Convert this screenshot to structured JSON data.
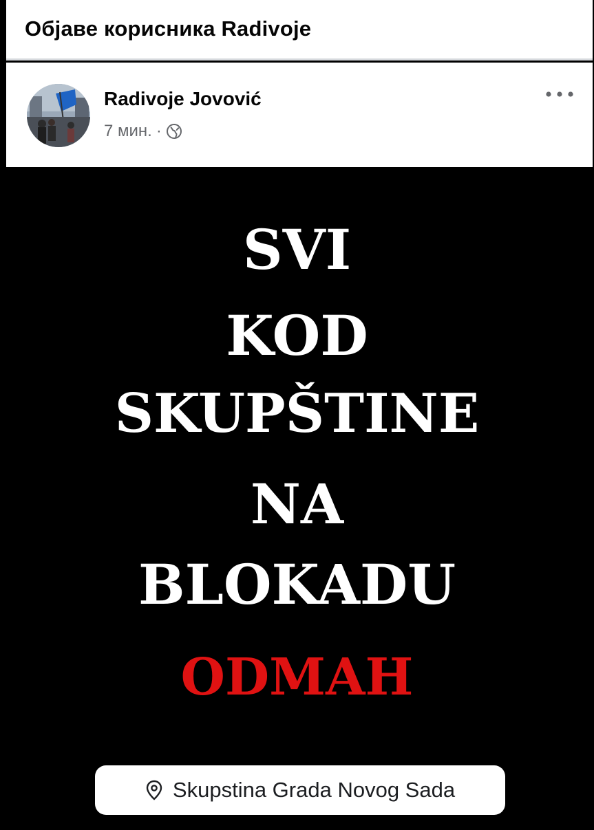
{
  "header": {
    "title": "Објаве корисника Radivoje"
  },
  "post": {
    "author": "Radivoje Jovović",
    "time": "7 мин.",
    "separator": "·",
    "privacy_icon": "globe-icon",
    "more_icon": "more-options-icon",
    "avatar": "profile-photo"
  },
  "image": {
    "lines": [
      "SVI",
      "KOD",
      "SKUPŠTINE",
      "NA",
      "BLOKADU",
      "ODMAH"
    ],
    "background_color": "#000000",
    "text_color": "#ffffff",
    "accent_color": "#e01212",
    "location": {
      "icon": "location-pin-icon",
      "label": "Skupstina Grada Novog Sada"
    }
  }
}
